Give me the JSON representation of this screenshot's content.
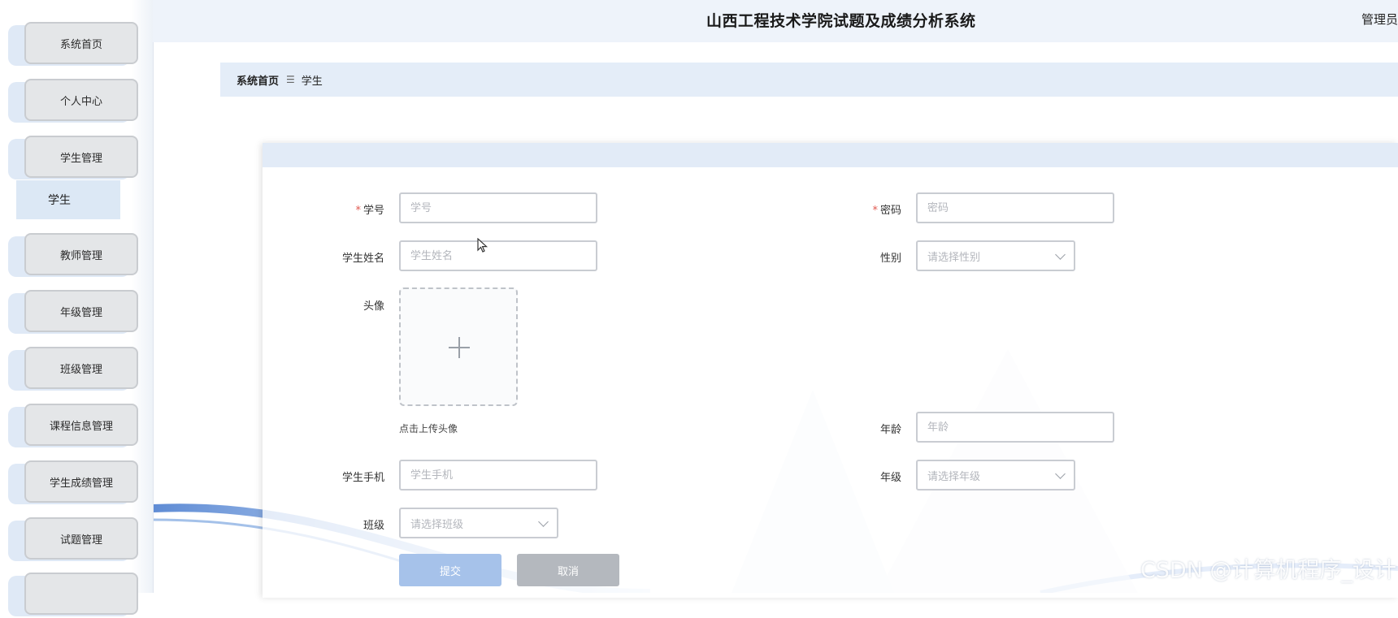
{
  "app": {
    "title": "山西工程技术学院试题及成绩分析系统",
    "user": "管理员"
  },
  "sidebar": {
    "items": [
      {
        "label": "系统首页"
      },
      {
        "label": "个人中心"
      },
      {
        "label": "学生管理"
      },
      {
        "label": "教师管理"
      },
      {
        "label": "年级管理"
      },
      {
        "label": "班级管理"
      },
      {
        "label": "课程信息管理"
      },
      {
        "label": "学生成绩管理"
      },
      {
        "label": "试题管理"
      }
    ],
    "subitem": {
      "label": "学生"
    }
  },
  "breadcrumb": {
    "home": "系统首页",
    "separator": "☰",
    "current": "学生"
  },
  "form": {
    "student_no": {
      "label": "学号",
      "placeholder": "学号"
    },
    "password": {
      "label": "密码",
      "placeholder": "密码"
    },
    "student_name": {
      "label": "学生姓名",
      "placeholder": "学生姓名"
    },
    "gender": {
      "label": "性别",
      "placeholder": "请选择性别"
    },
    "avatar": {
      "label": "头像",
      "hint": "点击上传头像"
    },
    "age": {
      "label": "年龄",
      "placeholder": "年龄"
    },
    "phone": {
      "label": "学生手机",
      "placeholder": "学生手机"
    },
    "grade": {
      "label": "年级",
      "placeholder": "请选择年级"
    },
    "class": {
      "label": "班级",
      "placeholder": "请选择班级"
    },
    "submit_label": "提交",
    "cancel_label": "取消"
  },
  "watermark": "CSDN @计算机程序_设计",
  "colors": {
    "accent": "#a6c2ea",
    "required": "#e0584f",
    "header_bg": "#eef3fa"
  }
}
